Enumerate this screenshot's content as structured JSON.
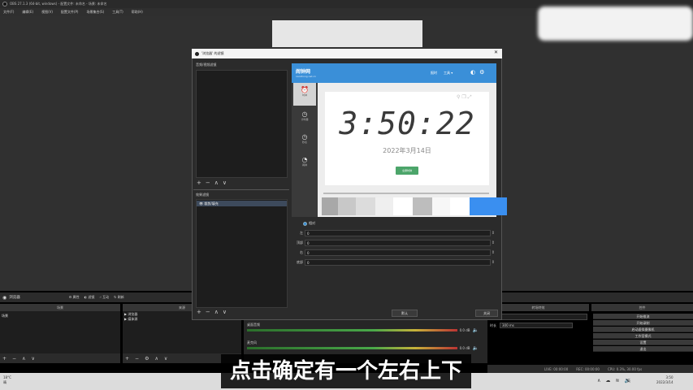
{
  "obs": {
    "title": "OBS 27.1.3 (64-bit, windows) - 配置文件: 未命名 - 场景: 未命名",
    "menu": [
      "文件(F)",
      "编辑(E)",
      "视图(V)",
      "配置文件(P)",
      "场景集合(S)",
      "工具(T)",
      "帮助(H)"
    ]
  },
  "docks": {
    "source_title": "浏览器",
    "toolbar_buttons": [
      "属性",
      "滤镜",
      "互动",
      "刷新"
    ],
    "scenes_header": "场景",
    "sources_header": "来源",
    "scenes_items": [
      "场景"
    ],
    "sources_items": [
      "浏览器",
      "媒体源"
    ],
    "transitions_header": "转场特效",
    "controls_header": "控件",
    "duration_label": "时长",
    "duration_value": "300 ms"
  },
  "mixer": {
    "label1": "桌面音频",
    "label2": "麦克风",
    "db1": "0.0 dB",
    "db2": "0.0 dB"
  },
  "controls": [
    "开始推流",
    "开始录制",
    "启动虚拟摄像机",
    "工作室模式",
    "设置",
    "退出"
  ],
  "statusbar": {
    "live": "LIVE: 00:00:00",
    "rec": "REC: 00:00:00",
    "cpu": "CPU: 0.3%, 30.00 fps"
  },
  "taskbar": {
    "temp": "18°C",
    "weather": "晴",
    "lang": "英",
    "time": "3:50",
    "date": "2022/3/14"
  },
  "dialog": {
    "title": "'浏览器' 的滤镜",
    "av_filters_label": "音频/视频滤镜",
    "effect_filters_label": "效果滤镜",
    "effect_item": "裁剪/填充",
    "defaults_btn": "默认",
    "close_btn": "关闭"
  },
  "web": {
    "logo": "闹钟网",
    "subtitle": "naozhong.net.cn",
    "nav": [
      "报时",
      "工具 ▾"
    ],
    "side_items": [
      "时钟",
      "计时器",
      "秒表",
      "闹钟"
    ],
    "clock_time": "3:50:22",
    "clock_date": "2022年3月14日",
    "clock_button": "全屏时钟"
  },
  "properties": {
    "relative_label": "相对",
    "rows": [
      {
        "label": "左",
        "value": "0"
      },
      {
        "label": "顶部",
        "value": "0"
      },
      {
        "label": "右",
        "value": "0"
      },
      {
        "label": "底部",
        "value": "0"
      }
    ]
  },
  "swatches": [
    "#a8a8a8",
    "#c8c8c8",
    "#dcdcdc",
    "#efefef",
    "#ffffff",
    "#bdbdbd",
    "#f7f7f7",
    "#ffffff",
    "#3a8ff0"
  ],
  "subtitle": "点击确定有一个左右上下",
  "colors": {
    "accent": "#3a8fd8",
    "dark": "#2b2b2b"
  }
}
